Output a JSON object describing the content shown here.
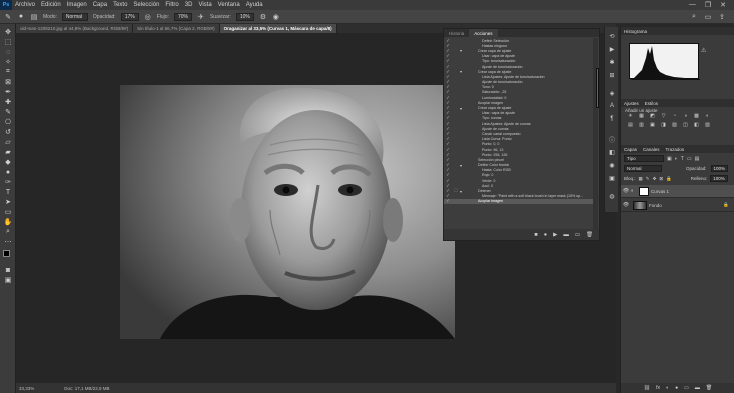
{
  "menubar": {
    "logo": "Ps",
    "items": [
      "Archivo",
      "Edición",
      "Imagen",
      "Capa",
      "Texto",
      "Selección",
      "Filtro",
      "3D",
      "Vista",
      "Ventana",
      "Ayuda"
    ],
    "controls": [
      "—",
      "❐",
      "✕"
    ]
  },
  "options": {
    "mode_label": "Modo:",
    "mode_value": "Normal",
    "opacity_label": "Opacidad:",
    "opacity_value": "17%",
    "flow_label": "Flujo:",
    "flow_value": "70%",
    "smooth_label": "Suavizar:",
    "smooth_value": "10%"
  },
  "tabs": [
    "old-man-1208210.jpg al 44,8% (Background, RGB/8#)",
    "Sin título-1 al 66,7% (Capa 2, RGB/8#)",
    "Oraganizar al 33,5% (Curvas 1, Máscara de capa/8)"
  ],
  "status": {
    "zoom": "33,33%",
    "doc": "Doc: 17,1 MB/22,9 MB"
  },
  "actions_panel": {
    "tab_history": "Historia",
    "tab_actions": "Acciones",
    "rows": [
      {
        "text": "Definir Selección",
        "lv": 1
      },
      {
        "text": "Hastas ninguno",
        "lv": 1
      },
      {
        "text": "Crear capa de ajuste",
        "lv": 0,
        "arrow": "▾"
      },
      {
        "text": "Usar: capa de ajuste",
        "lv": 1
      },
      {
        "text": "Tipo: tono/saturación",
        "lv": 1
      },
      {
        "text": "Ajuste de tono/saturación",
        "lv": 1
      },
      {
        "text": "Crear capa de ajuste",
        "lv": 0,
        "arrow": "▾"
      },
      {
        "text": "Lista Ajustes: Ajuste de tono/saturación",
        "lv": 1
      },
      {
        "text": "Ajuste de tono/saturación",
        "lv": 1
      },
      {
        "text": "Tono: 0",
        "lv": 1
      },
      {
        "text": "Saturación: -25",
        "lv": 1
      },
      {
        "text": "Luminosidad: 0",
        "lv": 1
      },
      {
        "text": "Acoplar imagen",
        "lv": 0
      },
      {
        "text": "Crear capa de ajuste",
        "lv": 0,
        "arrow": "▾"
      },
      {
        "text": "Usar: capa de ajuste",
        "lv": 1
      },
      {
        "text": "Tipo: curvas",
        "lv": 1
      },
      {
        "text": "Lista Ajustes: Ajuste de curvas",
        "lv": 1
      },
      {
        "text": "Ajuste de curvas",
        "lv": 1
      },
      {
        "text": "Canal: canal compuesto",
        "lv": 1
      },
      {
        "text": "Lista Curva: Punto",
        "lv": 1
      },
      {
        "text": "Punto: 0, 0",
        "lv": 1
      },
      {
        "text": "Punto: 96, 13",
        "lv": 1
      },
      {
        "text": "Punto: 255, 126",
        "lv": 1
      },
      {
        "text": "Selección pincel",
        "lv": 0
      },
      {
        "text": "Definir Color frontal",
        "lv": 0,
        "arrow": "▾"
      },
      {
        "text": "Hasta: Color RGB",
        "lv": 1
      },
      {
        "text": "Rojo: 0",
        "lv": 1
      },
      {
        "text": "Verde: 0",
        "lv": 1
      },
      {
        "text": "Azul: 0",
        "lv": 1
      },
      {
        "text": "Detener",
        "lv": 0,
        "arrow": "▾",
        "box": "☐"
      },
      {
        "text": "Mensaje: \"Paint with a soft black brush in layer mask (15% op...",
        "lv": 1
      },
      {
        "text": "Acoplar imagen",
        "lv": 0,
        "sel": true
      }
    ],
    "footer": [
      "■",
      "●",
      "▶",
      "▬",
      "▭",
      "🗑"
    ]
  },
  "histogram": {
    "title": "Histograma"
  },
  "adjustments": {
    "tab1": "Ajustes",
    "tab2": "Estilos",
    "subtitle": "Añadir un ajuste",
    "icons": [
      "☀",
      "▦",
      "◩",
      "▽",
      "◔",
      "◑",
      "▩",
      "◐",
      "▤",
      "▥",
      "▣",
      "◨",
      "▧",
      "◫",
      "◧",
      "▨"
    ]
  },
  "layers": {
    "tab1": "Capas",
    "tab2": "Canales",
    "tab3": "Trazados",
    "kind": "Tipo",
    "blend": "Normal",
    "opacity_label": "Opacidad:",
    "opacity": "100%",
    "lock_label": "Bloq.:",
    "fill_label": "Relleno:",
    "fill": "100%",
    "items": [
      {
        "name": "Curvas 1",
        "selected": true
      },
      {
        "name": "Fondo",
        "selected": false
      }
    ],
    "footer": [
      "⛓",
      "fx",
      "◐",
      "●",
      "▭",
      "▬",
      "🗑"
    ]
  },
  "colors": {
    "accent": "#2fa3f7",
    "panel": "#3b3b3b",
    "canvas": "#262626"
  }
}
